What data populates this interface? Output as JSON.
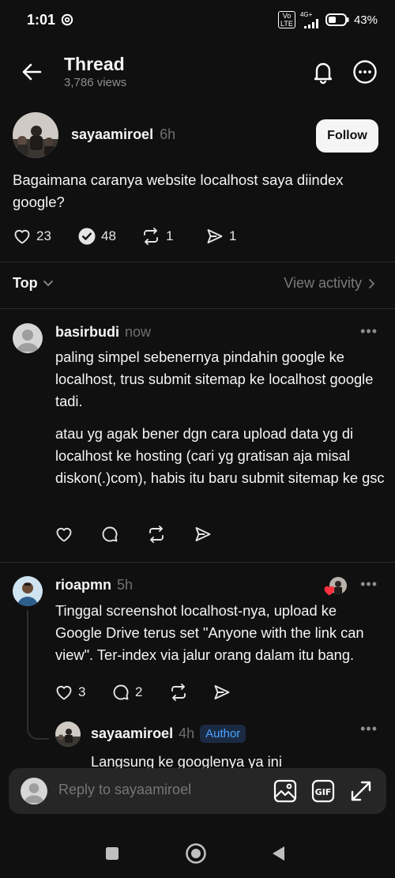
{
  "status": {
    "time": "1:01",
    "net": "4G+",
    "volte": "Vo LTE",
    "battery": "43%"
  },
  "header": {
    "title": "Thread",
    "views": "3,786 views"
  },
  "post": {
    "author": "sayaamiroel",
    "time": "6h",
    "follow_label": "Follow",
    "text": "Bagaimana caranya website localhost saya diindex google?",
    "likes": "23",
    "reposts_label": "48",
    "repost_count": "1",
    "shares": "1"
  },
  "sort": {
    "label": "Top",
    "view_activity": "View activity"
  },
  "replies": [
    {
      "author": "basirbudi",
      "time": "now",
      "paragraphs": [
        "paling simpel sebenernya pindahin google ke localhost, trus submit sitemap ke localhost google tadi.",
        "atau yg agak bener dgn cara upload data yg di localhost ke hosting (cari yg gratisan aja misal diskon(.)com), habis itu baru submit sitemap ke gsc"
      ]
    },
    {
      "author": "rioapmn",
      "time": "5h",
      "text": "Tinggal screenshot localhost-nya, upload ke Google Drive terus set \"Anyone with the link can view\". Ter-index via jalur orang dalam itu bang.",
      "likes": "3",
      "comments": "2"
    },
    {
      "author": "sayaamiroel",
      "time": "4h",
      "badge": "Author",
      "text": "Langsung ke googlenya ya ini"
    }
  ],
  "composer": {
    "placeholder": "Reply to sayaamiroel"
  },
  "colors": {
    "background": "#101010",
    "accent": "#4aa3ff",
    "heart": "#ff3040"
  }
}
